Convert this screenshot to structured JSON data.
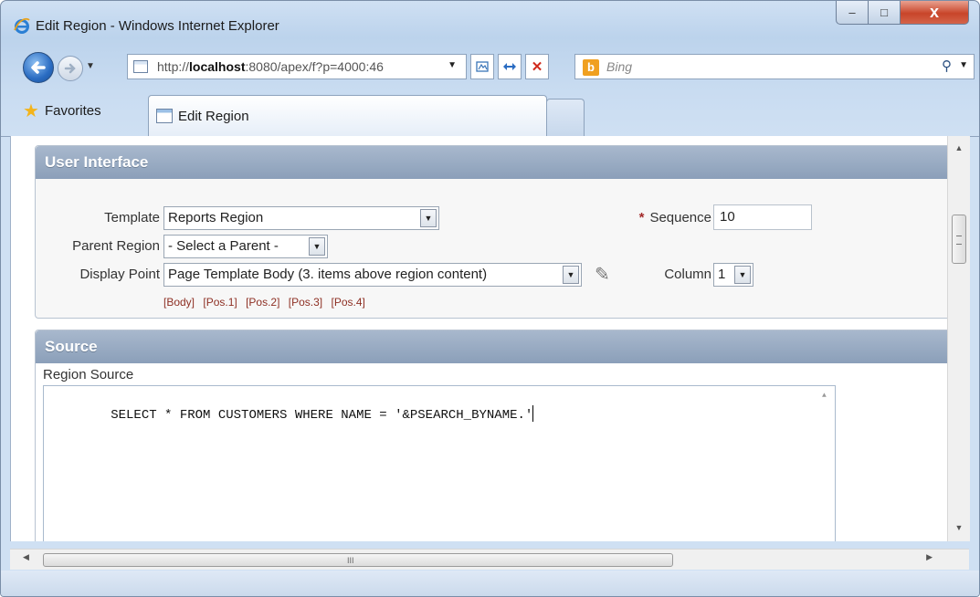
{
  "window": {
    "title": "Edit Region - Windows Internet Explorer",
    "controls": {
      "minimize": "‒",
      "maximize": "□",
      "close": "x"
    }
  },
  "navigation": {
    "url_prefix": "http://",
    "url_host": "localhost",
    "url_rest": ":8080/apex/f?p=4000:46",
    "search_placeholder": "Bing",
    "search_logo": "b"
  },
  "tabs": {
    "favorites_label": "Favorites",
    "active_tab_label": "Edit Region"
  },
  "user_interface": {
    "header": "User Interface",
    "template_label": "Template",
    "template_value": "Reports Region",
    "parent_region_label": "Parent Region",
    "parent_region_value": "- Select a Parent -",
    "display_point_label": "Display Point",
    "display_point_value": "Page Template Body (3. items above region content)",
    "sequence_required_marker": "*",
    "sequence_label": "Sequence",
    "sequence_value": "10",
    "column_label": "Column",
    "column_value": "1",
    "quick_links": [
      "[Body]",
      "[Pos.1]",
      "[Pos.2]",
      "[Pos.3]",
      "[Pos.4]"
    ]
  },
  "source": {
    "header": "Source",
    "region_source_label": "Region Source",
    "region_source_value": "SELECT * FROM CUSTOMERS WHERE NAME = '&PSEARCH_BYNAME.'"
  },
  "icons": {
    "ie_logo": "ie-logo-icon",
    "back": "back-arrow-icon",
    "forward": "forward-arrow-icon",
    "compat": "compatibility-view-icon",
    "refresh": "refresh-icon",
    "stop": "stop-icon",
    "search": "magnifier-icon",
    "pin": "pushpin-icon",
    "favorites": "star-icon"
  },
  "colors": {
    "region_header": "#8b9fb9",
    "quick_link": "#8e3024",
    "required_marker": "#a32b2b"
  }
}
